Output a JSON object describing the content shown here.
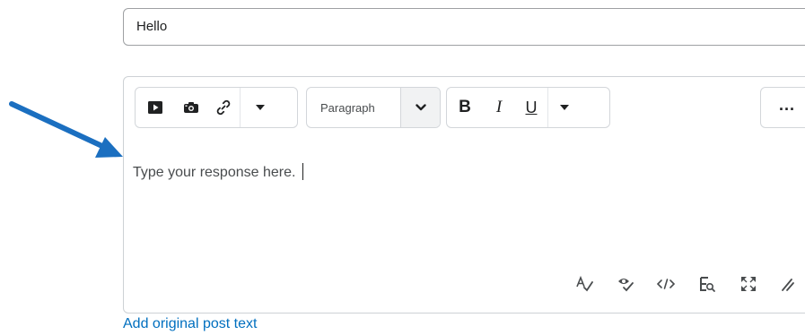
{
  "subject": {
    "value": "Hello"
  },
  "toolbar": {
    "format_label": "Paragraph",
    "bold_label": "B",
    "italic_label": "I",
    "underline_label": "U",
    "more_label": "..."
  },
  "editor": {
    "text": "Type your response here."
  },
  "links": {
    "add_original_post_text": "Add original post text"
  },
  "colors": {
    "link": "#006fbf",
    "arrow": "#1b6fc0",
    "border": "#cdd1d5"
  }
}
